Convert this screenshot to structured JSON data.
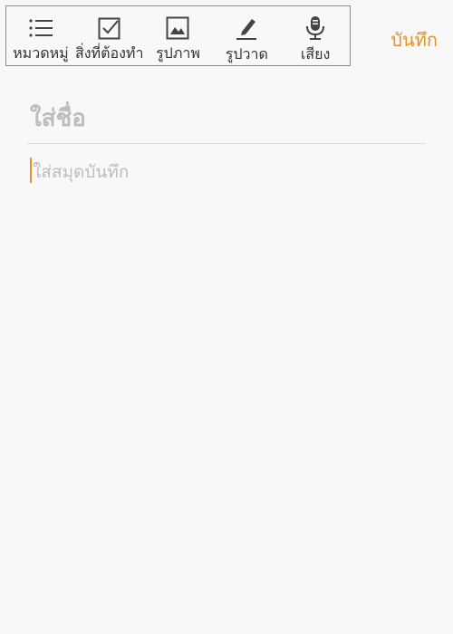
{
  "toolbar": {
    "items": [
      {
        "label": "หมวดหมู่",
        "icon": "list-icon"
      },
      {
        "label": "สิ่งที่ต้องทำ",
        "icon": "checkbox-icon"
      },
      {
        "label": "รูปภาพ",
        "icon": "image-icon"
      },
      {
        "label": "รูปวาด",
        "icon": "pen-icon"
      },
      {
        "label": "เสียง",
        "icon": "microphone-icon"
      }
    ]
  },
  "save_label": "บันทึก",
  "title_placeholder": "ใส่ชื่อ",
  "body_placeholder": "ใส่สมุดบันทึก",
  "colors": {
    "accent": "#e3952b",
    "icon": "#444444",
    "placeholder": "#bdbdbd",
    "background": "#f8f8f8"
  }
}
